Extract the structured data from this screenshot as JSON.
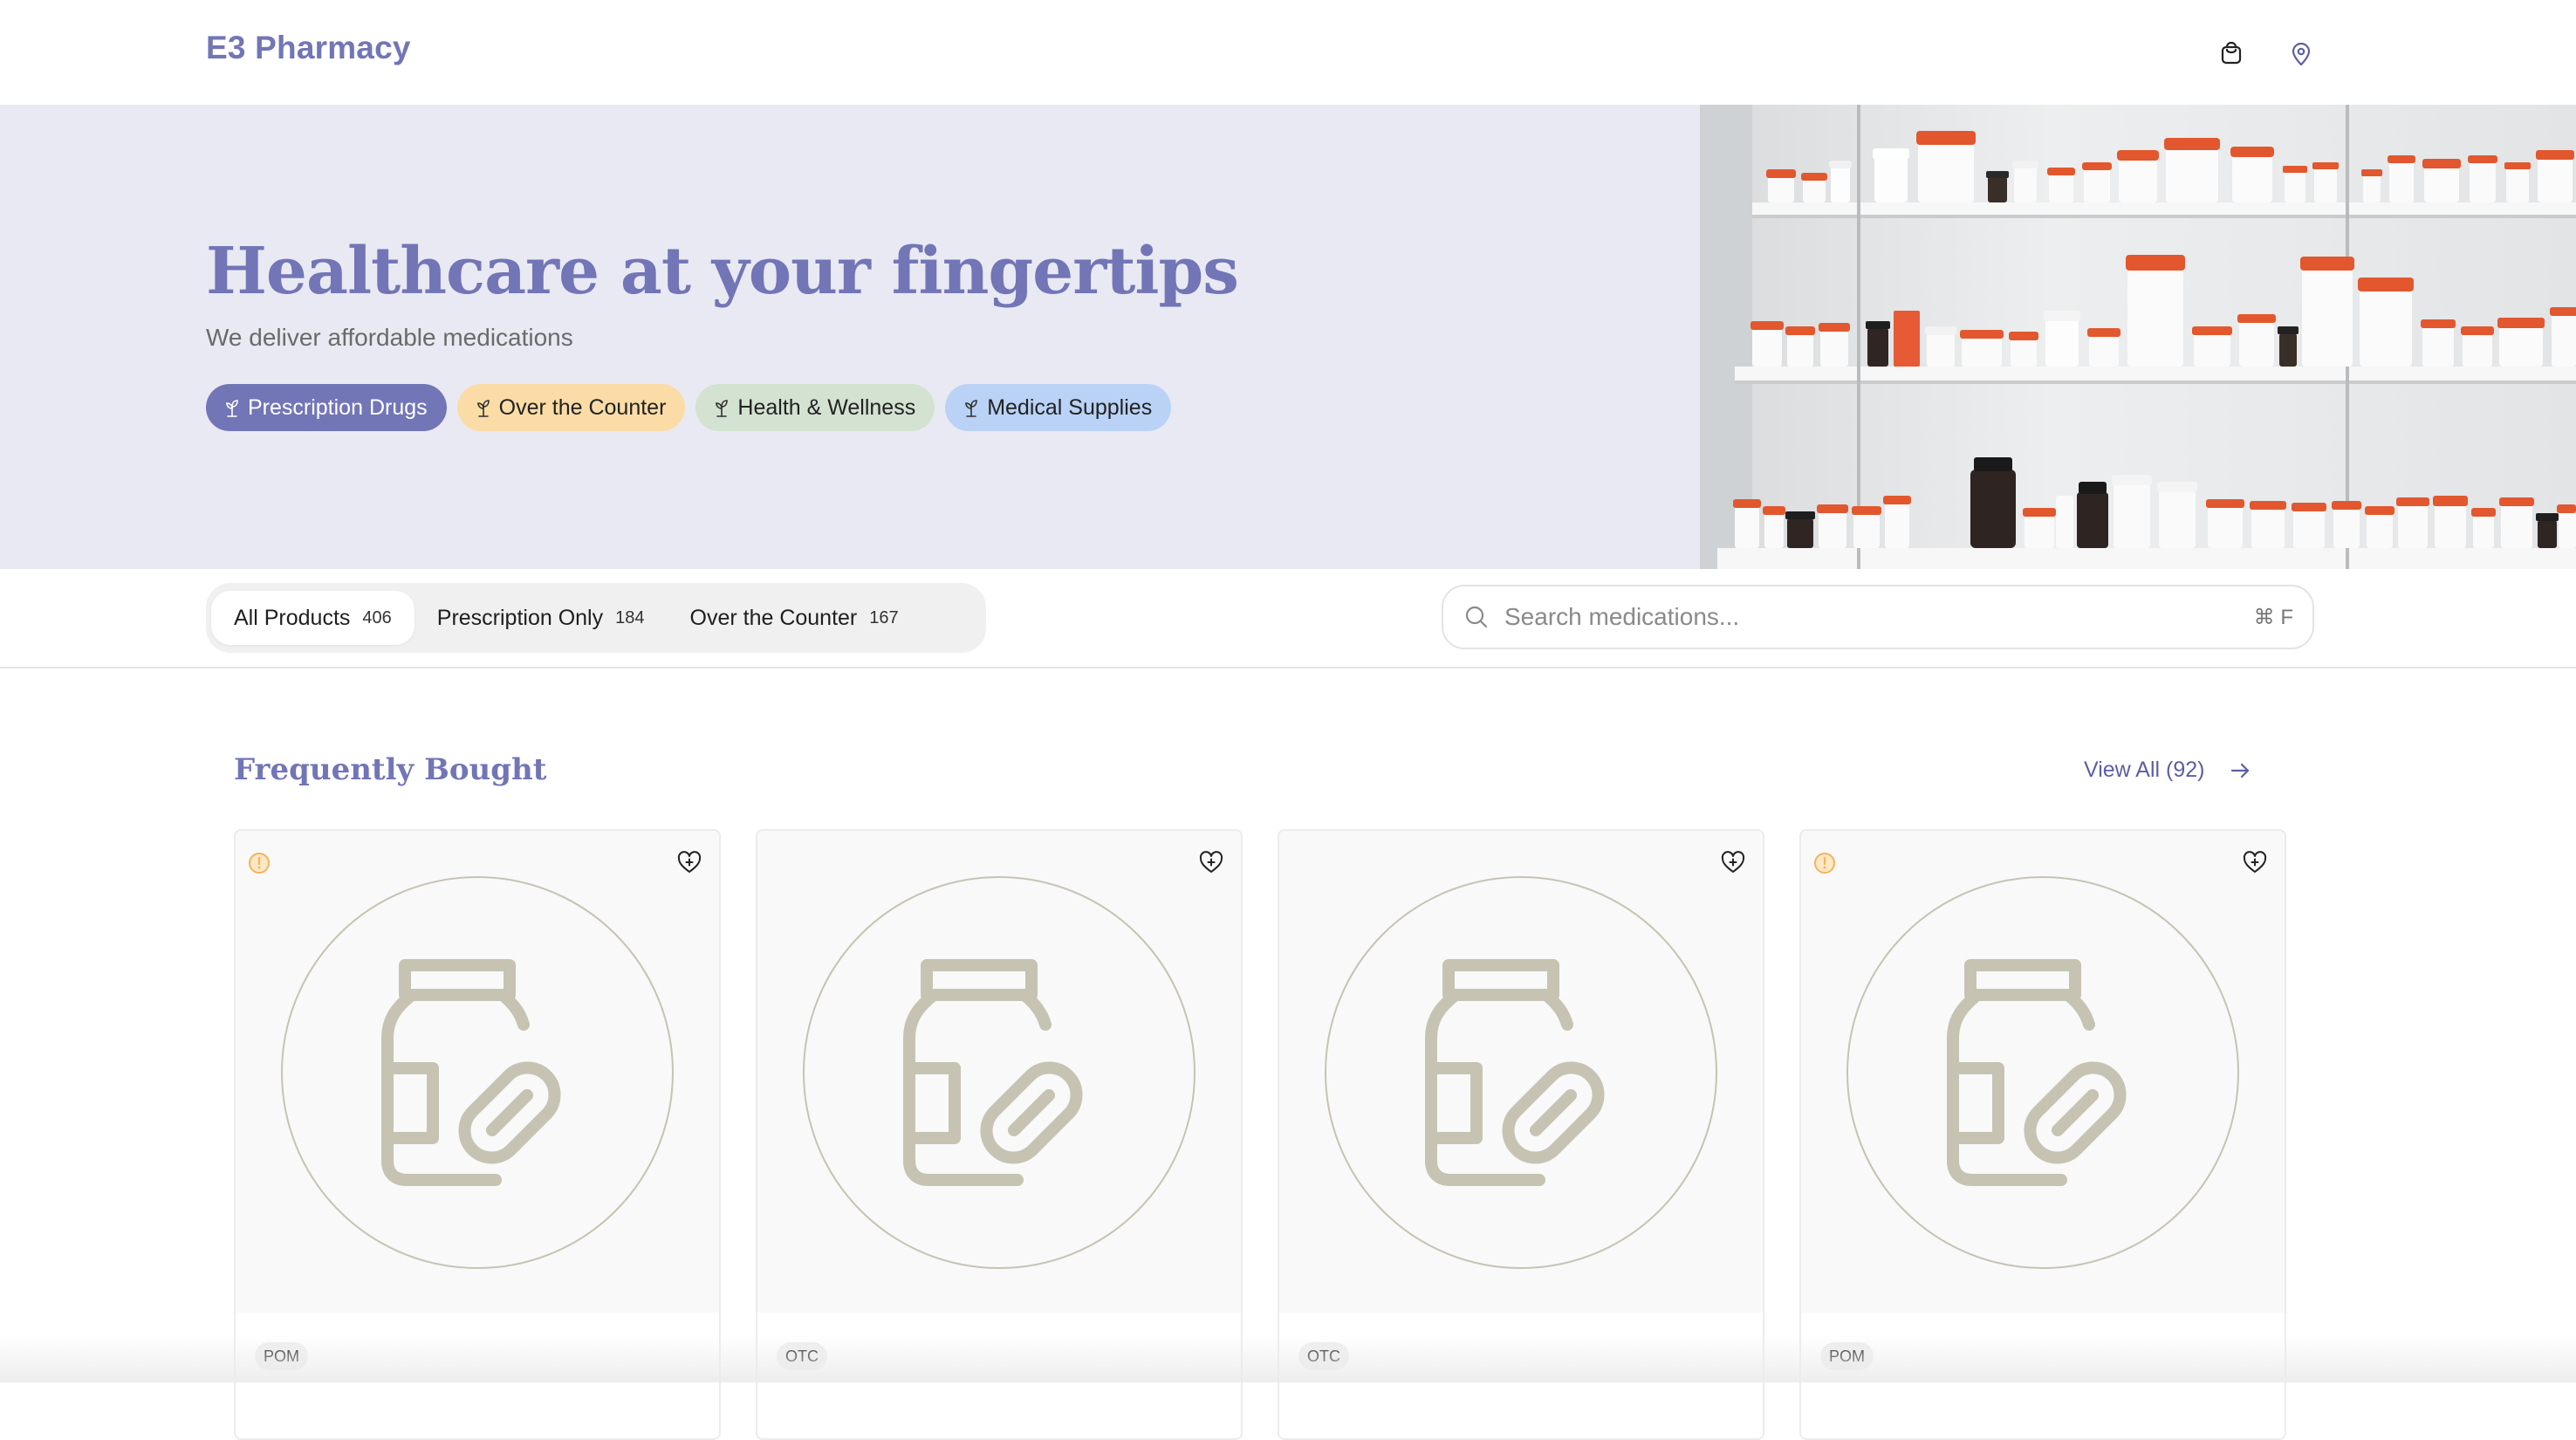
{
  "header": {
    "brand": "E3 Pharmacy",
    "icons": [
      "shopping-bag-icon",
      "location-pin-icon"
    ]
  },
  "hero": {
    "title": "Healthcare at your fingertips",
    "subtitle": "We deliver affordable medications",
    "chips": [
      {
        "label": "Prescription Drugs",
        "icon": "leaf-icon",
        "color": "#7275b6"
      },
      {
        "label": "Over the Counter",
        "icon": "leaf-icon",
        "color": "#fbdca6"
      },
      {
        "label": "Health & Wellness",
        "icon": "leaf-icon",
        "color": "#d3e2d1"
      },
      {
        "label": "Medical Supplies",
        "icon": "leaf-icon",
        "color": "#b9d2f6"
      }
    ],
    "image": "pharmacy-shelves-photo"
  },
  "filters": {
    "tabs": [
      {
        "label": "All Products",
        "count": "406",
        "active": true
      },
      {
        "label": "Prescription Only",
        "count": "184",
        "active": false
      },
      {
        "label": "Over the Counter",
        "count": "167",
        "active": false
      }
    ],
    "search": {
      "placeholder": "Search medications...",
      "shortcut": "⌘ F"
    }
  },
  "section": {
    "title": "Frequently Bought",
    "view_all": "View All (92)",
    "products": [
      {
        "tag": "POM",
        "warning": true
      },
      {
        "tag": "OTC",
        "warning": false
      },
      {
        "tag": "OTC",
        "warning": false
      },
      {
        "tag": "POM",
        "warning": true
      }
    ]
  },
  "colors": {
    "accent": "#7275b6",
    "hero_bg": "#e9e9f4",
    "warning": "#f3b45c",
    "placeholder_icon": "#c7c3b3"
  }
}
